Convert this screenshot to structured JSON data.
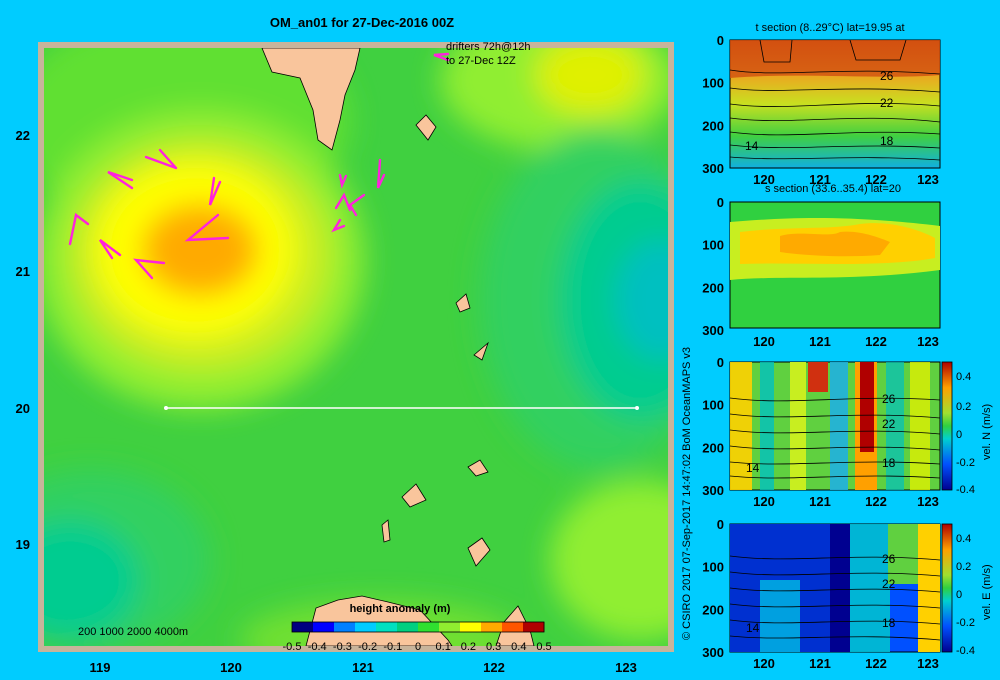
{
  "main_map": {
    "title": "OM_an01 for 27-Dec-2016 00Z",
    "drifter_note_line1": "drifters 72h@12h",
    "drifter_note_line2": "to 27-Dec 12Z",
    "lon_ticks": [
      "119",
      "120",
      "121",
      "122",
      "123"
    ],
    "lat_ticks": [
      "22",
      "21",
      "20",
      "19"
    ],
    "depth_legend": "200  1000  2000  4000m",
    "colorbar": {
      "title": "height anomaly (m)",
      "labels": [
        "-0.5",
        "-0.4",
        "-0.3",
        "-0.2",
        "-0.1",
        "0",
        "0.1",
        "0.2",
        "0.3",
        "0.4",
        "0.5"
      ],
      "colors": [
        "#000080",
        "#0000ff",
        "#0080ff",
        "#00ccff",
        "#00e0c0",
        "#00d080",
        "#30e030",
        "#90ee30",
        "#ffff00",
        "#ffaa00",
        "#ff5500",
        "#b00000"
      ]
    },
    "section_line": {
      "lat": 20,
      "lon_start": 119.5,
      "lon_end": 123.2
    },
    "colors": {
      "outer_bg": "#00ccff",
      "frame": "#c8b49b",
      "land": "#f9c59c",
      "drifter": "#ff22dd"
    }
  },
  "credit": "© CSIRO 2017   07-Sep-2017 14:47:02 BoM OceanMAPS v3",
  "panels": [
    {
      "title": "t section (8..29°C) lat=19.95 at",
      "contour_labels": [
        "26",
        "22",
        "18",
        "14"
      ],
      "cb": null
    },
    {
      "title": "s section (33.6..35.4) lat=20",
      "contour_labels": [],
      "cb": null
    },
    {
      "title": "",
      "contour_labels": [
        "26",
        "22",
        "18",
        "14"
      ],
      "cb": {
        "label": "vel. N (m/s)",
        "ticks": [
          "0.4",
          "0.2",
          "0",
          "-0.2",
          "-0.4"
        ]
      }
    },
    {
      "title": "",
      "contour_labels": [
        "26",
        "22",
        "18",
        "14"
      ],
      "cb": {
        "label": "vel. E (m/s)",
        "ticks": [
          "0.4",
          "0.2",
          "0",
          "-0.2",
          "-0.4"
        ]
      }
    }
  ],
  "panel_axes": {
    "depth_ticks": [
      "0",
      "100",
      "200",
      "300"
    ],
    "lon_ticks": [
      "120",
      "121",
      "122",
      "123"
    ]
  }
}
